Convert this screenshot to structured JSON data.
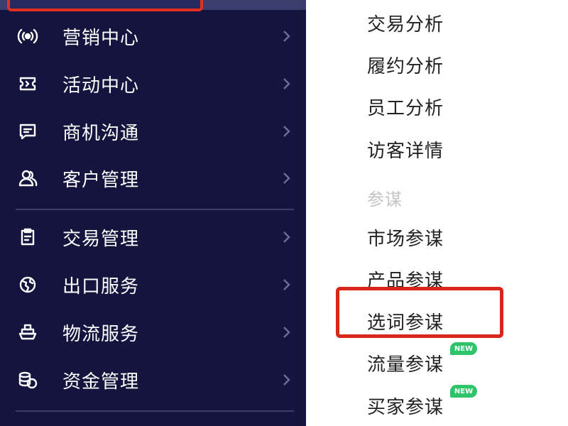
{
  "sidebar": {
    "items": [
      {
        "label": "营销中心",
        "icon": "broadcast-icon"
      },
      {
        "label": "活动中心",
        "icon": "ticket-icon"
      },
      {
        "label": "商机沟通",
        "icon": "message-icon"
      },
      {
        "label": "客户管理",
        "icon": "users-icon"
      },
      {
        "label": "交易管理",
        "icon": "clipboard-icon"
      },
      {
        "label": "出口服务",
        "icon": "globe-icon"
      },
      {
        "label": "物流服务",
        "icon": "ship-icon"
      },
      {
        "label": "资金管理",
        "icon": "coins-icon"
      }
    ],
    "chevron_icon": "chevron-right-icon"
  },
  "submenu": {
    "items": [
      {
        "label": "交易分析"
      },
      {
        "label": "履约分析"
      },
      {
        "label": "员工分析"
      },
      {
        "label": "访客详情"
      }
    ],
    "group_title": "参谋",
    "group_items": [
      {
        "label": "市场参谋"
      },
      {
        "label": "产品参谋"
      },
      {
        "label": "选词参谋",
        "highlighted": true
      },
      {
        "label": "流量参谋",
        "badge": "NEW"
      },
      {
        "label": "买家参谋",
        "badge": "NEW"
      }
    ]
  },
  "colors": {
    "sidebar_bg": "#14143e",
    "highlight_border": "#d8261a",
    "badge_bg": "#2fc36a"
  }
}
